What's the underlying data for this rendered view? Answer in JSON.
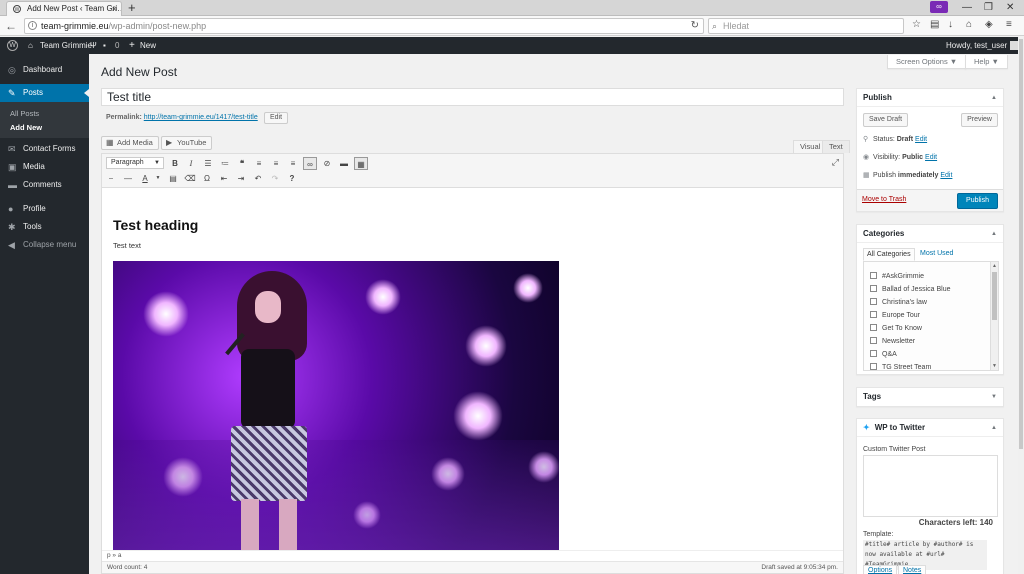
{
  "browser": {
    "tab_title": "Add New Post ‹ Team Gri…",
    "tab_close": "×",
    "new_tab": "+",
    "window_controls": [
      "—",
      "❐",
      "✕"
    ],
    "url_host": "team-grimmie.eu",
    "url_path": "/wp-admin/post-new.php",
    "search_placeholder": "Hledat",
    "toolbar_icons": [
      "star-icon",
      "clipboard-icon",
      "download-icon",
      "home-icon",
      "pocket-icon",
      "menu-icon"
    ]
  },
  "adminbar": {
    "site_name": "Team Grimmie",
    "comments_count": "0",
    "new_label": "New",
    "howdy": "Howdy, test_user"
  },
  "sidebar": {
    "items": [
      {
        "label": "Dashboard",
        "icon": "dashboard-icon"
      },
      {
        "label": "Posts",
        "icon": "pin-icon"
      },
      {
        "label": "Contact Forms",
        "icon": "mail-icon"
      },
      {
        "label": "Media",
        "icon": "media-icon"
      },
      {
        "label": "Comments",
        "icon": "comment-icon"
      },
      {
        "label": "Profile",
        "icon": "user-icon"
      },
      {
        "label": "Tools",
        "icon": "wrench-icon"
      },
      {
        "label": "Collapse menu",
        "icon": "collapse-icon"
      }
    ],
    "submenu": [
      "All Posts",
      "Add New"
    ]
  },
  "header": {
    "title": "Add New Post",
    "screen_options": "Screen Options ▼",
    "help": "Help ▼"
  },
  "editor": {
    "post_title": "Test title",
    "permalink_label": "Permalink:",
    "permalink_url": "http://team-grimmie.eu/1417/test-title",
    "edit_btn": "Edit",
    "add_media": "Add Media",
    "youtube": "YouTube",
    "tab_visual": "Visual",
    "tab_text": "Text",
    "format_select": "Paragraph",
    "content_heading": "Test heading",
    "content_text": "Test text",
    "path": "p » a",
    "word_count": "Word count: 4",
    "draft_saved": "Draft saved at 9:05:34 pm."
  },
  "publish": {
    "title": "Publish",
    "save_draft": "Save Draft",
    "preview": "Preview",
    "status_label": "Status:",
    "status_value": "Draft",
    "visibility_label": "Visibility:",
    "visibility_value": "Public",
    "publish_label": "Publish",
    "publish_value": "immediately",
    "edit": "Edit",
    "trash": "Move to Trash",
    "publish_btn": "Publish"
  },
  "categories": {
    "title": "Categories",
    "tab_all": "All Categories",
    "tab_most": "Most Used",
    "items": [
      "#AskGrimmie",
      "Ballad of Jessica Blue",
      "Christina's law",
      "Europe Tour",
      "Get To Know",
      "Newsletter",
      "Q&A",
      "TG Street Team"
    ]
  },
  "tags": {
    "title": "Tags"
  },
  "twitter": {
    "title": "WP to Twitter",
    "custom_label": "Custom Twitter Post",
    "chars_left": "Characters left: 140",
    "template_label": "Template:",
    "template_text": "#title# article by #author# is now available at #url# #TeamGrimmie",
    "tab_options": "Options",
    "tab_notes": "Notes"
  },
  "colors": {
    "accent": "#0073aa",
    "adminbar": "#23282d",
    "primary_btn": "#0085ba"
  }
}
